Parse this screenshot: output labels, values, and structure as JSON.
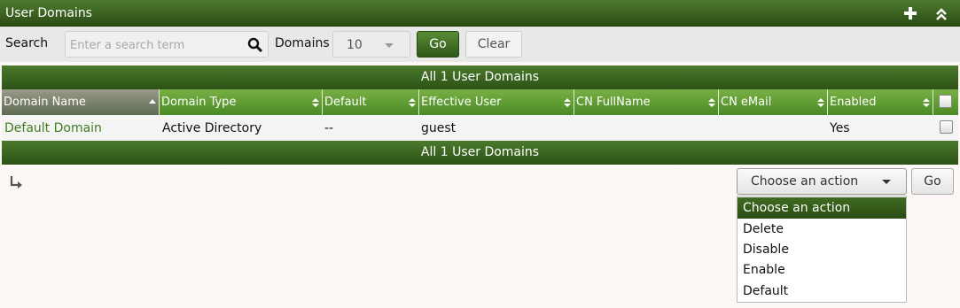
{
  "header": {
    "title": "User Domains",
    "add_icon": "plus-icon",
    "collapse_icon": "double-chevron-up-icon"
  },
  "search": {
    "label": "Search",
    "placeholder": "Enter a search term",
    "value": "",
    "icon": "search-icon",
    "domains_label": "Domains",
    "page_size": "10",
    "go_label": "Go",
    "clear_label": "Clear"
  },
  "table": {
    "summary_top": "All 1 User Domains",
    "summary_bottom": "All 1 User Domains",
    "columns": [
      "Domain Name",
      "Domain Type",
      "Default",
      "Effective User",
      "CN FullName",
      "CN eMail",
      "Enabled"
    ],
    "rows": [
      {
        "domain_name": "Default Domain",
        "domain_type": "Active Directory",
        "default": "--",
        "effective_user": "guest",
        "cn_fullname": "",
        "cn_email": "",
        "enabled": "Yes"
      }
    ],
    "link_color": "#3f7d1f"
  },
  "actions": {
    "selected": "Choose an action",
    "go_label": "Go",
    "options": [
      "Choose an action",
      "Delete",
      "Disable",
      "Enable",
      "Default"
    ]
  },
  "colors": {
    "header_green": "#2b4d14",
    "column_green": "#5a9a30",
    "button_green": "#3f6b22"
  }
}
